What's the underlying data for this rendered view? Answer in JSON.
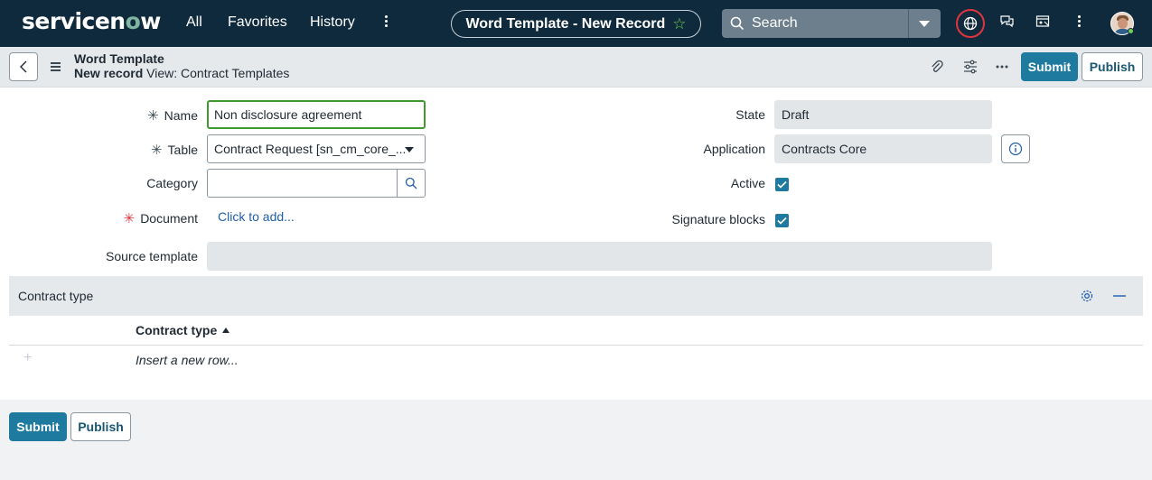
{
  "topnav": {
    "logo_prefix": "servicen",
    "logo_o": "o",
    "logo_suffix": "w",
    "links": [
      "All",
      "Favorites",
      "History"
    ],
    "record_title": "Word Template - New Record",
    "search_placeholder": "Search"
  },
  "form_header": {
    "table_name": "Word Template",
    "record_state": "New record",
    "view_label": "View: Contract Templates",
    "submit_label": "Submit",
    "publish_label": "Publish"
  },
  "fields": {
    "name": {
      "label": "Name",
      "value": "Non disclosure agreement",
      "required": true
    },
    "table": {
      "label": "Table",
      "value": "Contract Request [sn_cm_core_...",
      "required": true
    },
    "category": {
      "label": "Category",
      "value": ""
    },
    "document": {
      "label": "Document",
      "link": "Click to add...",
      "required": true
    },
    "source_template": {
      "label": "Source template",
      "value": ""
    },
    "state": {
      "label": "State",
      "value": "Draft"
    },
    "application": {
      "label": "Application",
      "value": "Contracts Core"
    },
    "active": {
      "label": "Active",
      "checked": true
    },
    "signature_blocks": {
      "label": "Signature blocks",
      "checked": true
    }
  },
  "related_list": {
    "title": "Contract type",
    "column": "Contract type",
    "insert_row": "Insert a new row..."
  },
  "footer": {
    "submit_label": "Submit",
    "publish_label": "Publish"
  },
  "colors": {
    "nav_bg": "#0f2a3c",
    "primary": "#1f7aa0",
    "focus_green": "#3e9a2e",
    "required_red": "#e0343f"
  }
}
